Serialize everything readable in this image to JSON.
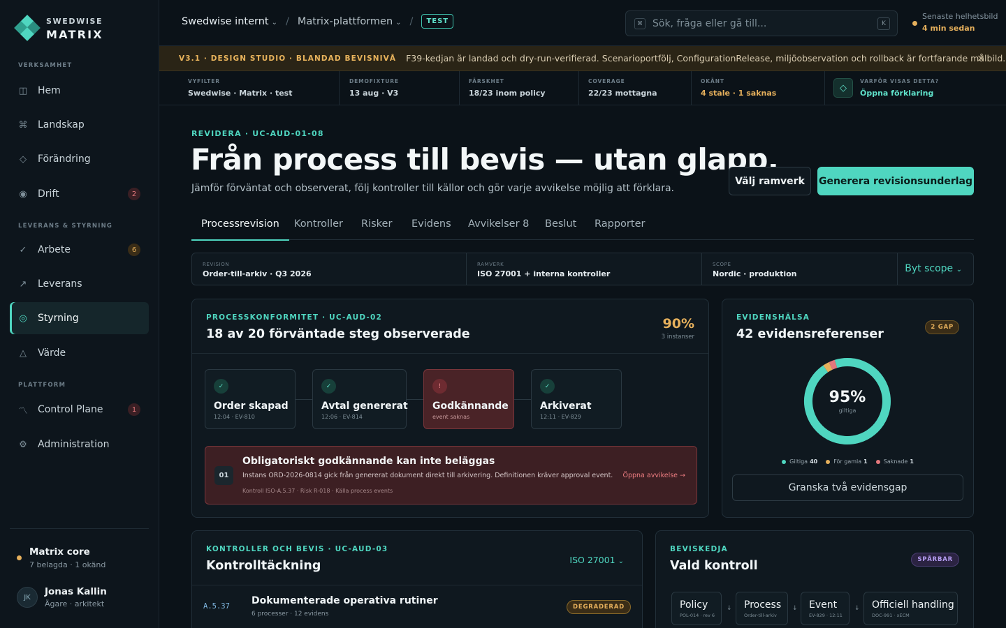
{
  "colors": {
    "accent": "#4fd6c0",
    "warning": "#e6b05c",
    "danger": "#e4787c",
    "background": "#0b1218"
  },
  "brand": {
    "line1": "SWEDWISE",
    "line2": "MATRIX"
  },
  "sidebar": {
    "sections": [
      {
        "label": "VERKSAMHET"
      },
      {
        "label": "LEVERANS & STYRNING"
      },
      {
        "label": "PLATTFORM"
      }
    ],
    "items": [
      {
        "label": "Hem",
        "icon": "book-icon"
      },
      {
        "label": "Landskap",
        "icon": "command-icon"
      },
      {
        "label": "Förändring",
        "icon": "diamond-icon"
      },
      {
        "label": "Drift",
        "icon": "target-icon",
        "badge": "2"
      },
      {
        "label": "Arbete",
        "icon": "check-icon",
        "badge": "6"
      },
      {
        "label": "Leverans",
        "icon": "arrow-up-right-icon"
      },
      {
        "label": "Styrning",
        "icon": "circle-icon",
        "active": true
      },
      {
        "label": "Värde",
        "icon": "triangle-icon"
      },
      {
        "label": "Control Plane",
        "icon": "pulse-icon",
        "badge": "1"
      },
      {
        "label": "Administration",
        "icon": "gear-icon"
      }
    ],
    "core": {
      "title": "Matrix core",
      "subtitle": "7 belagda · 1 okänd"
    },
    "user": {
      "initials": "JK",
      "name": "Jonas Kallin",
      "role": "Ägare · arkitekt"
    }
  },
  "topbar": {
    "breadcrumbs": [
      "Swedwise internt",
      "Matrix-plattformen"
    ],
    "env_tag": "TEST",
    "search_placeholder": "Sök, fråga eller gå till...",
    "search_icon_glyph": "⌘",
    "search_shortcut": "K",
    "health_label": "Senaste helhetsbild",
    "health_value": "4 min sedan"
  },
  "banner": {
    "tag": "V3.1 · DESIGN STUDIO · BLANDAD BEVISNIVÅ",
    "message": "F39-kedjan är landad och dry-run-verifierad. Scenarioportfölj, ConfigurationRelease, miljöobservation och rollback är fortfarande målbild.",
    "close_glyph": "×"
  },
  "meta": [
    {
      "key": "VYFILTER",
      "value": "Swedwise · Matrix · test"
    },
    {
      "key": "DEMOFIXTURE",
      "value": "13 aug · V3"
    },
    {
      "key": "FÄRSKHET",
      "value": "18/23 inom policy"
    },
    {
      "key": "COVERAGE",
      "value": "22/23 mottagna"
    },
    {
      "key": "OKÄNT",
      "value": "4 stale · 1 saknas"
    },
    {
      "key": "VARFÖR VISAS DETTA?",
      "value": "Öppna förklaring"
    }
  ],
  "page": {
    "eyebrow": "REVIDERA · UC-AUD-01-08",
    "title": "Från process till bevis — utan glapp.",
    "subtitle": "Jämför förväntat och observerat, följ kontroller till källor och gör varje avvikelse möjlig att förklara.",
    "btn_secondary": "Välj ramverk",
    "btn_primary": "Generera revisionsunderlag"
  },
  "tabs": [
    "Processrevision",
    "Kontroller",
    "Risker",
    "Evidens",
    "Avvikelser 8",
    "Beslut",
    "Rapporter"
  ],
  "scope": {
    "cells": [
      {
        "key": "REVISION",
        "value": "Order-till-arkiv · Q3 2026"
      },
      {
        "key": "RAMVERK",
        "value": "ISO 27001 + interna kontroller"
      },
      {
        "key": "SCOPE",
        "value": "Nordic · produktion"
      }
    ],
    "button": "Byt scope"
  },
  "conformity": {
    "eyebrow": "PROCESSKONFORMITET · UC-AUD-02",
    "title": "18 av 20 förväntade steg observerade",
    "percent": "90%",
    "percent_sub": "3 instanser",
    "steps": [
      {
        "name": "Order skapad",
        "meta": "12:04 · EV-810",
        "status": "ok",
        "glyph": "✓"
      },
      {
        "name": "Avtal genererat",
        "meta": "12:06 · EV-814",
        "status": "ok",
        "glyph": "✓"
      },
      {
        "name": "Godkännande",
        "meta": "event saknas",
        "status": "error",
        "glyph": "!"
      },
      {
        "name": "Arkiverat",
        "meta": "12:11 · EV-829",
        "status": "ok",
        "glyph": "✓"
      }
    ],
    "alert": {
      "num": "01",
      "title": "Obligatoriskt godkännande kan inte beläggas",
      "desc": "Instans ORD-2026-0814 gick från genererat dokument direkt till arkivering. Definitionen kräver approval event.",
      "meta": "Kontroll ISO-A.5.37 · Risk R-018 · Källa process events",
      "link": "Öppna avvikelse →"
    }
  },
  "evidence": {
    "eyebrow": "EVIDENSHÄLSA",
    "title": "42 evidensreferenser",
    "badge": "2 GAP",
    "percent": "95%",
    "percent_sub": "giltiga",
    "segments": [
      {
        "label": "Giltiga",
        "count": 40,
        "color": "#4fd6c0"
      },
      {
        "label": "För gamla",
        "count": 1,
        "color": "#e6b05c"
      },
      {
        "label": "Saknade",
        "count": 1,
        "color": "#e4787c"
      }
    ],
    "button": "Granska två evidensgap"
  },
  "controls": {
    "eyebrow": "KONTROLLER OCH BEVIS · UC-AUD-03",
    "title": "Kontrolltäckning",
    "framework": "ISO 27001",
    "rows": [
      {
        "code": "A.5.37",
        "name": "Dokumenterade operativa rutiner",
        "meta": "6 processer · 12 evidens",
        "badge": "DEGRADERAD"
      }
    ]
  },
  "chain": {
    "eyebrow": "BEVISKEDJA",
    "title": "Vald kontroll",
    "badge": "SPÅRBAR",
    "nodes": [
      {
        "name": "Policy",
        "meta": "POL-014 · rev 6"
      },
      {
        "name": "Process",
        "meta": "Order-till-arkiv"
      },
      {
        "name": "Event",
        "meta": "EV-829 · 12:11"
      },
      {
        "name": "Officiell handling",
        "meta": "DOC-991 · xECM"
      }
    ],
    "arrow_glyph": "↓"
  }
}
